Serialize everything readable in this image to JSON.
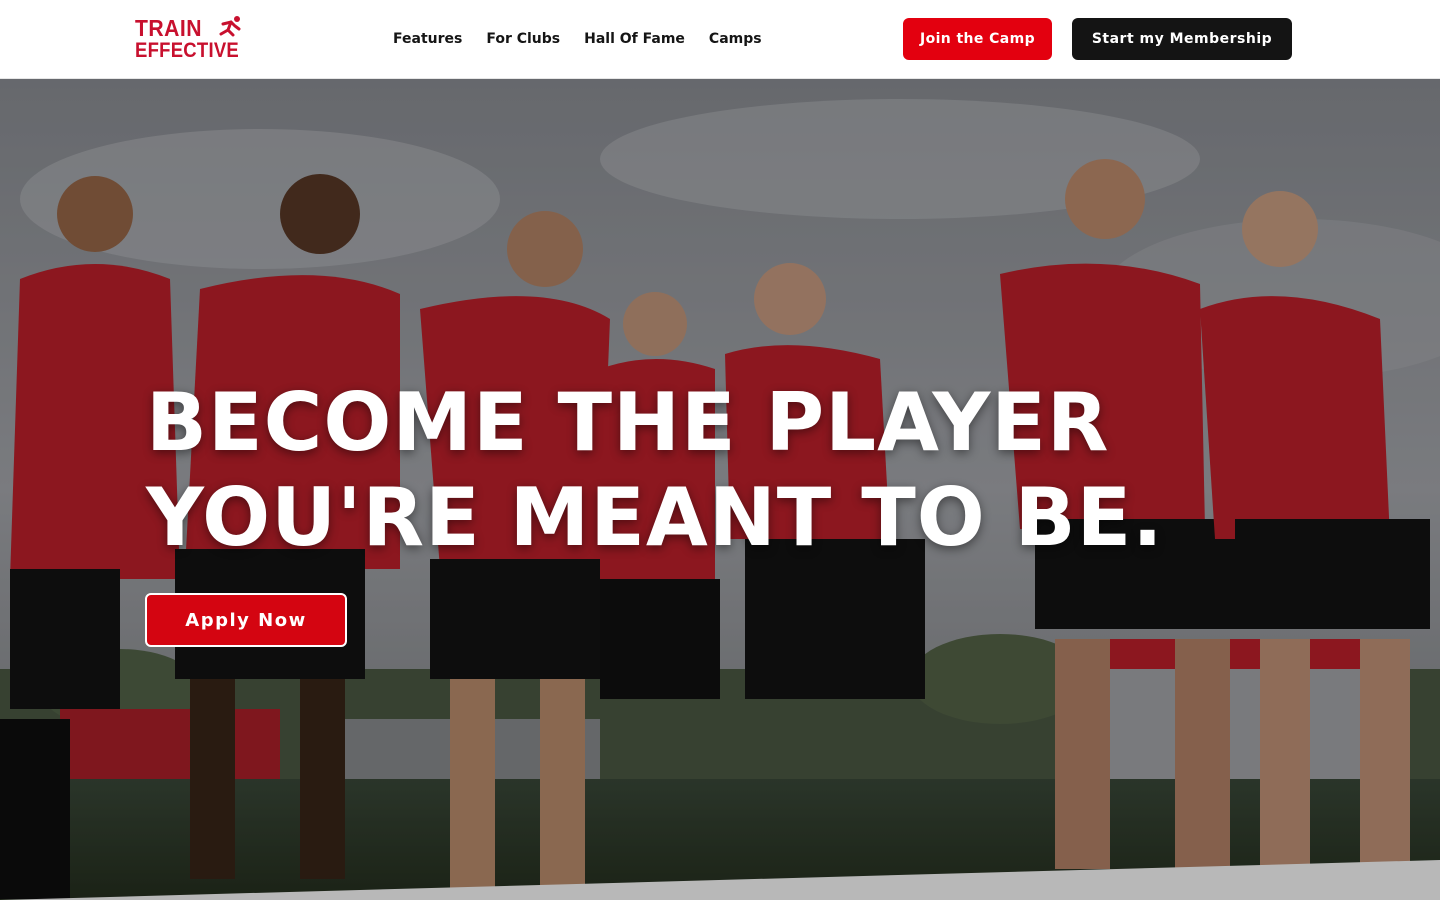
{
  "header": {
    "logo": {
      "line1": "TRAIN",
      "line2": "EFFECTIVE",
      "icon": "runner-icon"
    },
    "nav": [
      {
        "label": "Features"
      },
      {
        "label": "For Clubs"
      },
      {
        "label": "Hall Of Fame"
      },
      {
        "label": "Camps"
      }
    ],
    "join_camp_label": "Join the Camp",
    "membership_label": "Start my Membership"
  },
  "hero": {
    "title_line1": "BECOME THE PLAYER",
    "title_line2": "YOU'RE MEANT TO BE.",
    "cta_label": "Apply Now",
    "image": "football-team-photo"
  },
  "colors": {
    "brand_red": "#c8102e",
    "button_red": "#e3000f",
    "dark": "#141414",
    "white": "#ffffff"
  }
}
